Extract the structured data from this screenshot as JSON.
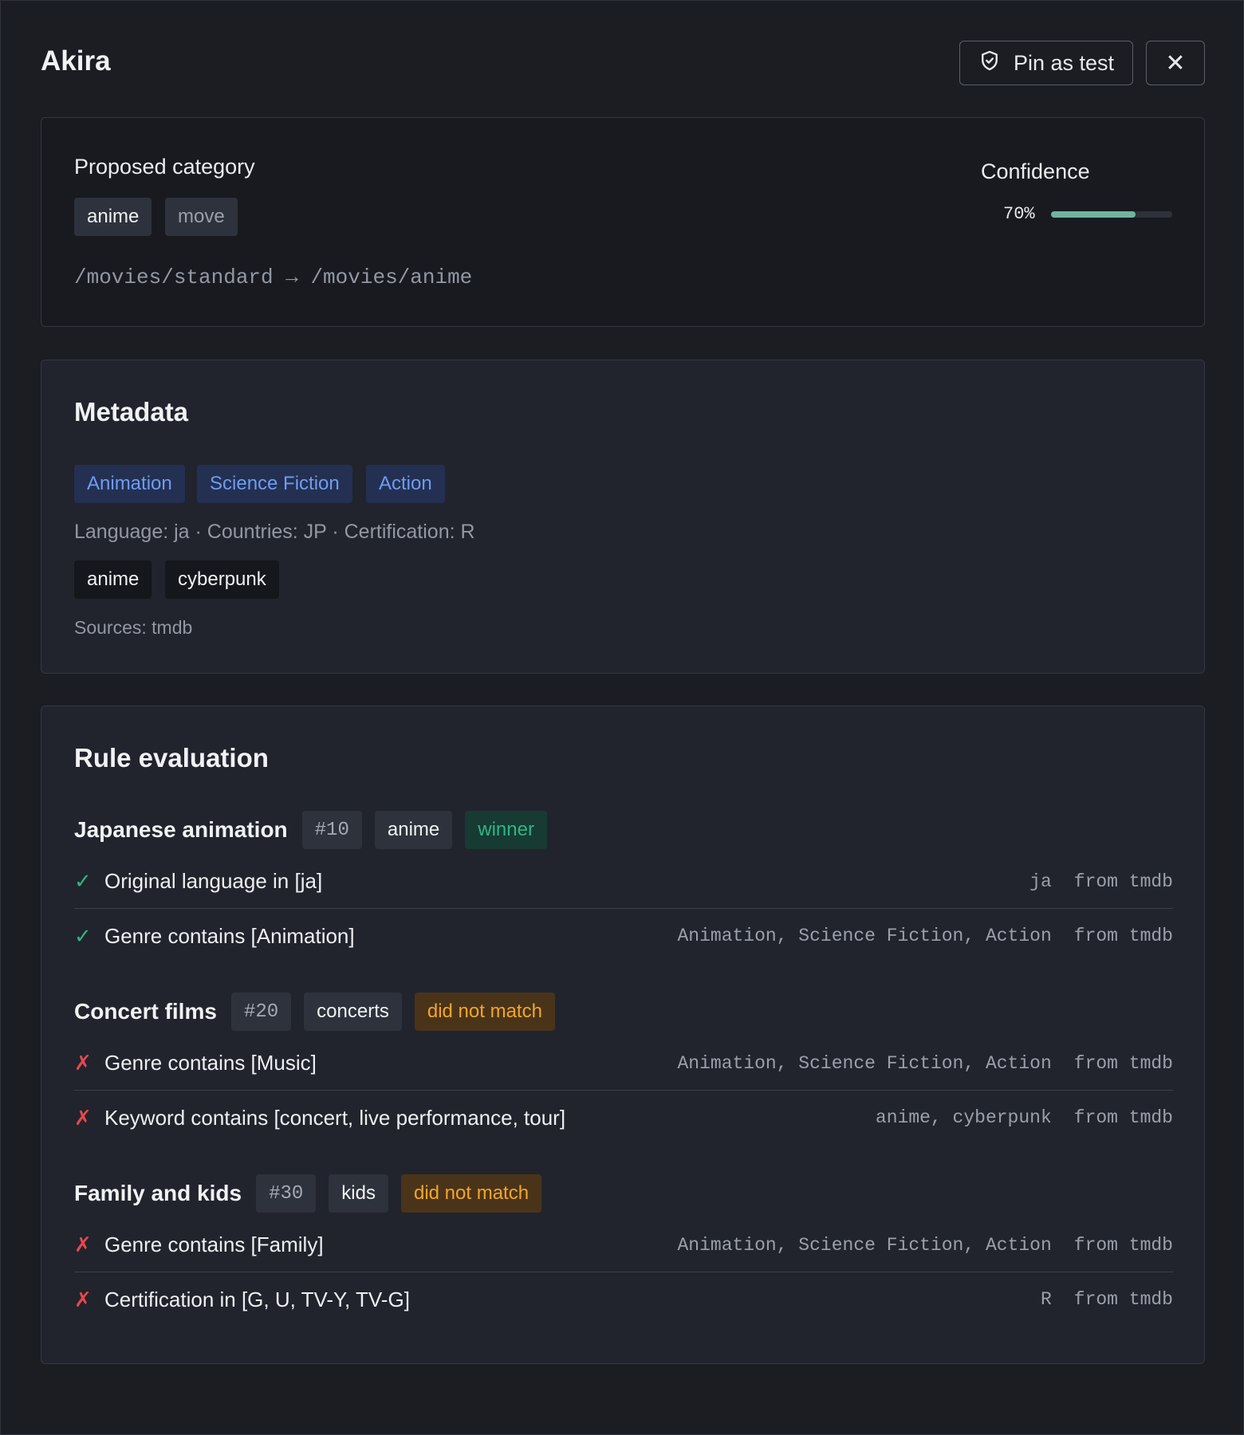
{
  "header": {
    "title": "Akira",
    "pin_label": "Pin as test",
    "close_label": "✕"
  },
  "proposed": {
    "heading": "Proposed category",
    "category_chip": "anime",
    "action_chip": "move",
    "path": "/movies/standard → /movies/anime",
    "confidence_label": "Confidence",
    "confidence_text": "70%",
    "confidence_value": 0.7
  },
  "metadata": {
    "heading": "Metadata",
    "genres": [
      "Animation",
      "Science Fiction",
      "Action"
    ],
    "details": "Language: ja · Countries: JP · Certification: R",
    "keywords": [
      "anime",
      "cyberpunk"
    ],
    "sources": "Sources: tmdb"
  },
  "rules": {
    "heading": "Rule evaluation",
    "groups": [
      {
        "name": "Japanese animation",
        "id": "#10",
        "category": "anime",
        "status": "winner",
        "conditions": [
          {
            "ok": true,
            "mark": "✓",
            "text": "Original language in [ja]",
            "value": "ja",
            "source": "from tmdb"
          },
          {
            "ok": true,
            "mark": "✓",
            "text": "Genre contains [Animation]",
            "value": "Animation, Science Fiction, Action",
            "source": "from tmdb"
          }
        ]
      },
      {
        "name": "Concert films",
        "id": "#20",
        "category": "concerts",
        "status": "did not match",
        "conditions": [
          {
            "ok": false,
            "mark": "✗",
            "text": "Genre contains [Music]",
            "value": "Animation, Science Fiction, Action",
            "source": "from tmdb"
          },
          {
            "ok": false,
            "mark": "✗",
            "text": "Keyword contains [concert, live performance, tour]",
            "value": "anime, cyberpunk",
            "source": "from tmdb"
          }
        ]
      },
      {
        "name": "Family and kids",
        "id": "#30",
        "category": "kids",
        "status": "did not match",
        "conditions": [
          {
            "ok": false,
            "mark": "✗",
            "text": "Genre contains [Family]",
            "value": "Animation, Science Fiction, Action",
            "source": "from tmdb"
          },
          {
            "ok": false,
            "mark": "✗",
            "text": "Certification in [G, U, TV-Y, TV-G]",
            "value": "R",
            "source": "from tmdb"
          }
        ]
      }
    ]
  },
  "colors": {
    "background": "#1b1d23",
    "success": "#2fb584",
    "warning": "#f2a52e",
    "error": "#e5484d",
    "genre_text": "#6f9cf0",
    "confidence_bar": "#6fb59d"
  },
  "icons": {
    "pin": "shield-check-icon",
    "close": "close-icon",
    "match": "check-icon",
    "no_match": "cross-icon"
  }
}
